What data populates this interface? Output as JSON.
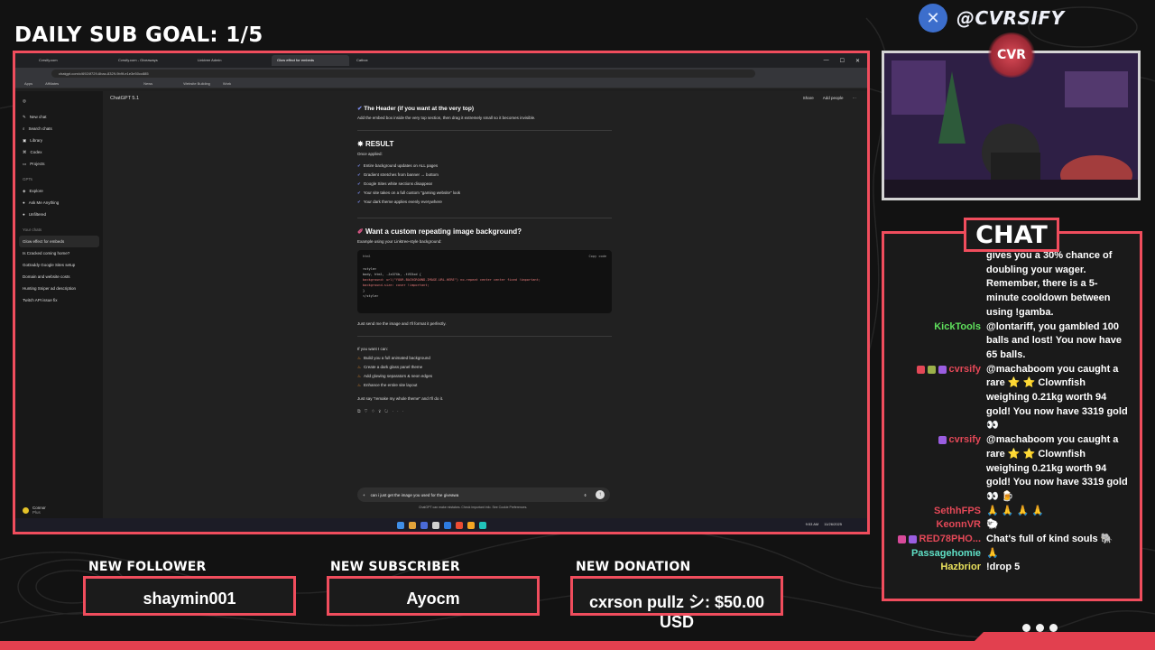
{
  "overlay": {
    "daily_goal": "DAILY SUB GOAL: 1/5",
    "handle": "@CVRSIFY",
    "cam_logo": "CVR",
    "chat_title": "CHAT",
    "accent_color": "#f04d5d"
  },
  "browser": {
    "tabs": [
      "Cvrsify.com",
      "Cvrsify.com - Giveaways",
      "Linktree Admin",
      "Glow effect for embeds",
      "Catbox"
    ],
    "active_tab": 3,
    "url": "chatgpt.com/c/6924f729-6bac-8329-9b9f-e1e3e50cc885",
    "bookmarks": [
      "Apps",
      "Affiliates",
      "News",
      "Website Building",
      "Work"
    ]
  },
  "chatgpt": {
    "sidebar_actions": [
      "New chat",
      "Search chats",
      "Library",
      "Codex",
      "Projects"
    ],
    "gpts_label": "GPTs",
    "gpts": [
      "Explore",
      "Ask Me Anything",
      "Unfiltered"
    ],
    "chats_label": "Your chats",
    "chats": [
      "Glow effect for embeds",
      "Is Cracked coming home?",
      "GoDaddy Google Sites setup",
      "Domain and website costs",
      "Hunting Sniper ad description",
      "Twitch API issue fix"
    ],
    "user_name": "Connor",
    "user_plan": "Plus",
    "model": "ChatGPT 5.1",
    "share": "Share",
    "add_people": "Add people",
    "header_heading": "The Header (if you want at the very top)",
    "header_text": "Add the embed box inside the very top section, then drag it extremely small so it becomes invisible.",
    "result_heading": "RESULT",
    "result_intro": "Once applied:",
    "result_items": [
      "Entire background updates on ALL pages",
      "Gradient stretches from banner → bottom",
      "Google Sites white sections disappear",
      "Your site takes on a full custom \"gaming website\" look",
      "Your dark theme applies evenly everywhere"
    ],
    "custom_heading": "Want a custom repeating image background?",
    "custom_intro": "Example using your Linktree-style background:",
    "code_lang": "html",
    "code_copy": "Copy code",
    "code_lines": [
      "<style>",
      "body, html, .JzO7Xb, .tVS5xd {",
      "   background: url(\"YOUR-BACKGROUND-IMAGE-URL-HERE\") no-repeat center center fixed !important;",
      "   background-size: cover !important;",
      "}",
      "</style>"
    ],
    "after_code": "Just send me the image and I'll format it perfectly.",
    "offer_intro": "If you want I can:",
    "offer_items": [
      "Build you a full animated background",
      "Create a dark glass panel theme",
      "Add glowing separators & neon edges",
      "Enhance the entire site layout"
    ],
    "offer_close": "Just say \"remake my whole theme\" and I'll do it.",
    "input_text": "can i just get the image you used for the giveawa",
    "disclaimer": "ChatGPT can make mistakes. Check important info. See Cookie Preferences.",
    "clock_time": "9:53 AM",
    "clock_date": "11/26/2025"
  },
  "chat": {
    "messages": [
      {
        "user": "",
        "color": "#ffffff",
        "badges": [],
        "text": "gives you a 30% chance of doubling your wager. Remember, there is a 5-minute cooldown between using !gamba."
      },
      {
        "user": "KickTools",
        "color": "#5fe05c",
        "badges": [],
        "text": "@lontariff, you gambled 100 balls and lost! You now have 65 balls."
      },
      {
        "user": "cvrsify",
        "color": "#e34857",
        "badges": [
          "#e34857",
          "#9bb04a",
          "#9a5de0"
        ],
        "text": "@machaboom you caught a rare ⭐ ⭐ Clownfish weighing 0.21kg worth 94 gold! You now have 3319 gold 👀"
      },
      {
        "user": "cvrsify",
        "color": "#e34857",
        "badges": [
          "#9a5de0"
        ],
        "text": "@machaboom you caught a rare ⭐ ⭐ Clownfish weighing 0.21kg worth 94 gold! You now have 3319 gold 👀 🍺"
      },
      {
        "user": "SethhFPS",
        "color": "#e34857",
        "badges": [],
        "text": "🙏 🙏 🙏 🙏"
      },
      {
        "user": "KeonnVR",
        "color": "#e34857",
        "badges": [],
        "text": "🐑"
      },
      {
        "user": "RED78PHO...",
        "color": "#e34857",
        "badges": [
          "#d84a9a",
          "#9a5de0"
        ],
        "text": "Chat's full of kind souls 🐘"
      },
      {
        "user": "Passagehomie",
        "color": "#5fe0c6",
        "badges": [],
        "text": "🙏"
      },
      {
        "user": "Hazbrior",
        "color": "#e8e05c",
        "badges": [],
        "text": "!drop 5"
      }
    ]
  },
  "alerts": [
    {
      "label": "NEW FOLLOWER",
      "value": "shaymin001"
    },
    {
      "label": "NEW SUBSCRIBER",
      "value": "Ayocm"
    },
    {
      "label": "NEW DONATION",
      "value": "cxrson pullz シ: $50.00 USD"
    }
  ]
}
